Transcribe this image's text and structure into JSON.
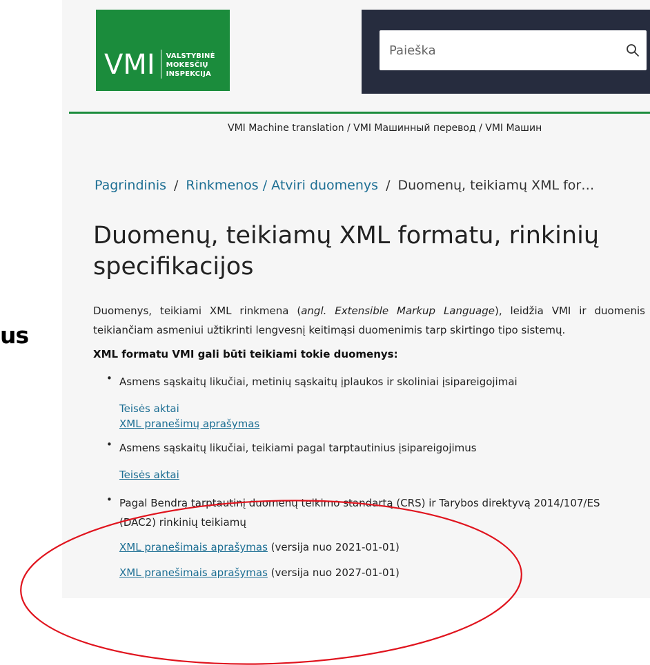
{
  "side_fragment": "us",
  "header": {
    "logo_text": "VMI",
    "logo_lines": [
      "VALSTYBINĖ",
      "MOKESČIŲ",
      "INSPEKCIJA"
    ],
    "search_placeholder": "Paieška",
    "search_icon": "search-icon"
  },
  "machine_translation": "VMI Machine translation / VMI Машинный перевод / VMI Машин",
  "breadcrumb": {
    "home": "Pagrindinis",
    "section": "Rinkmenos / Atviri duomenys",
    "current": "Duomenų, teikiamų XML for…"
  },
  "page_title": "Duomenų, teikiamų XML formatu, rinkinių specifikacijos",
  "intro": {
    "part1": "Duomenys, teikiami XML rinkmena (",
    "italic": "angl. Extensible Markup Language",
    "part2": "), leidžia VMI ir duomenis",
    "line2": "teikiančiam asmeniui užtikrinti lengvesnį keitimąsi duomenimis tarp skirtingo tipo sistemų."
  },
  "subheading": "XML formatu VMI gali būti teikiami tokie duomenys:",
  "items": [
    {
      "text": "Asmens sąskaitų likučiai, metinių sąskaitų įplaukos ir skoliniai įsipareigojimai",
      "link1": "Teisės aktai",
      "link2": "XML pranešimų aprašymas"
    },
    {
      "text": "Asmens sąskaitų likučiai, teikiami pagal tarptautinius įsipareigojimus",
      "link1": "Teisės aktai"
    },
    {
      "text_line1": "Pagal Bendrą tarptautinį duomenų teikimo standartą (CRS) ir Tarybos direktyvą 2014/107/ES",
      "text_line2": "(DAC2) rinkinių teikiamų",
      "link1": "XML pranešimais aprašymas",
      "suffix1": " (versija nuo 2021-01-01)",
      "link2": "XML pranešimais aprašymas",
      "suffix2": " (versija nuo 2027-01-01)"
    }
  ],
  "annotation": {
    "ellipse_color": "#e0141e"
  }
}
